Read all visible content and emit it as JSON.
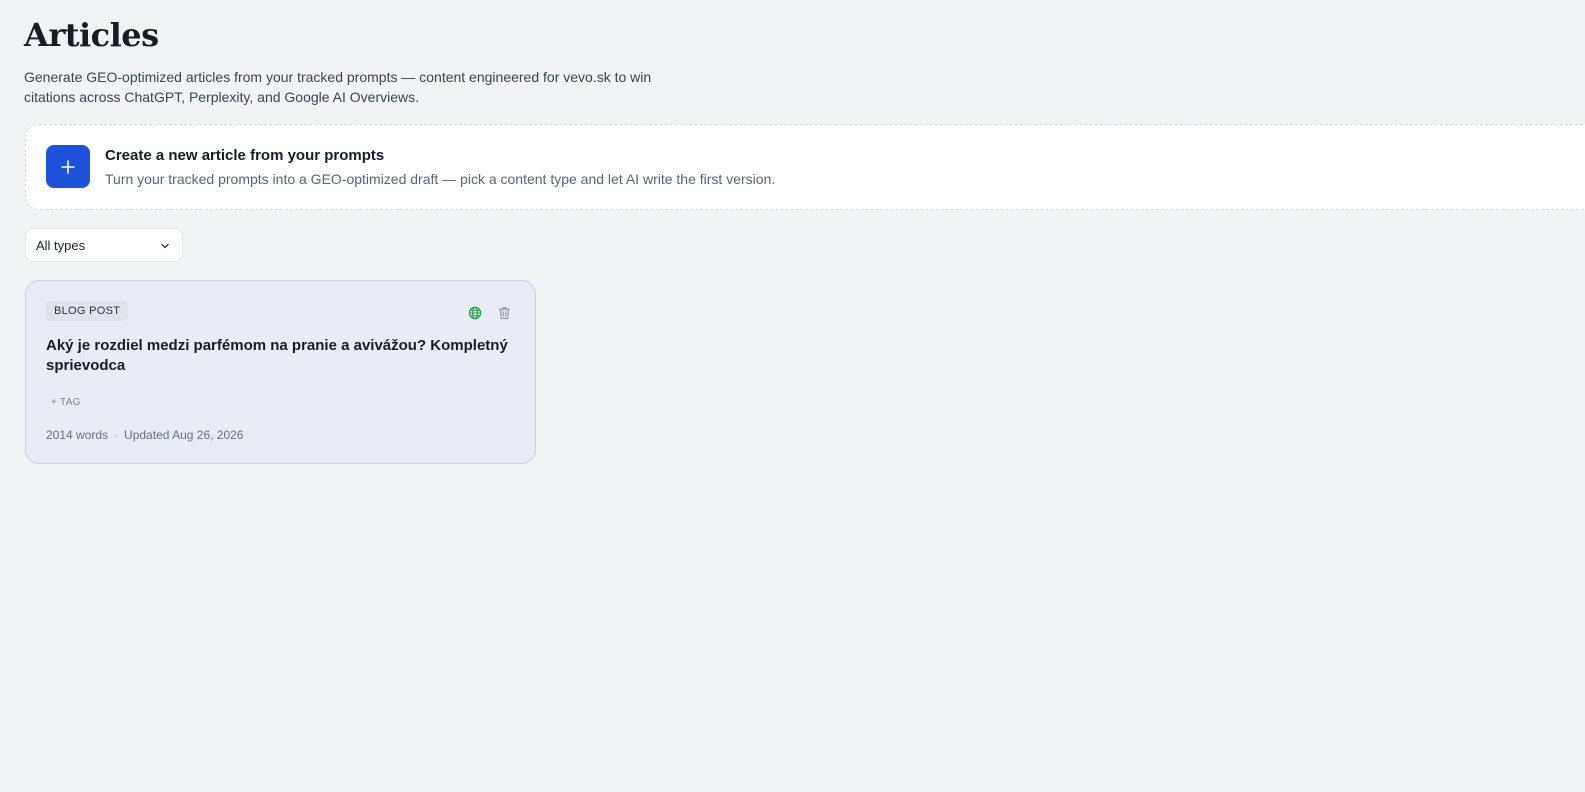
{
  "header": {
    "title": "Articles",
    "subtitle": "Generate GEO-optimized articles from your tracked prompts — content engineered for vevo.sk to win citations across ChatGPT, Perplexity, and Google AI Overviews."
  },
  "create_card": {
    "icon": "plus-icon",
    "title": "Create a new article from your prompts",
    "description": "Turn your tracked prompts into a GEO-optimized draft — pick a content type and let AI write the first version."
  },
  "filter": {
    "selected": "All types",
    "icon": "chevron-down-icon"
  },
  "articles": [
    {
      "type_badge": "BLOG POST",
      "title": "Aký je rozdiel medzi parfémom na pranie a avivážou? Kompletný sprievodca",
      "add_tag_label": "+ TAG",
      "word_count": "2014 words",
      "separator": "·",
      "updated": "Updated Aug 26, 2026",
      "icons": [
        "globe-icon",
        "trash-icon"
      ]
    }
  ],
  "colors": {
    "accent": "#1e52db",
    "published_green": "#16a34a",
    "background": "#f2f3f5",
    "card_background": "#e9ebf5"
  }
}
